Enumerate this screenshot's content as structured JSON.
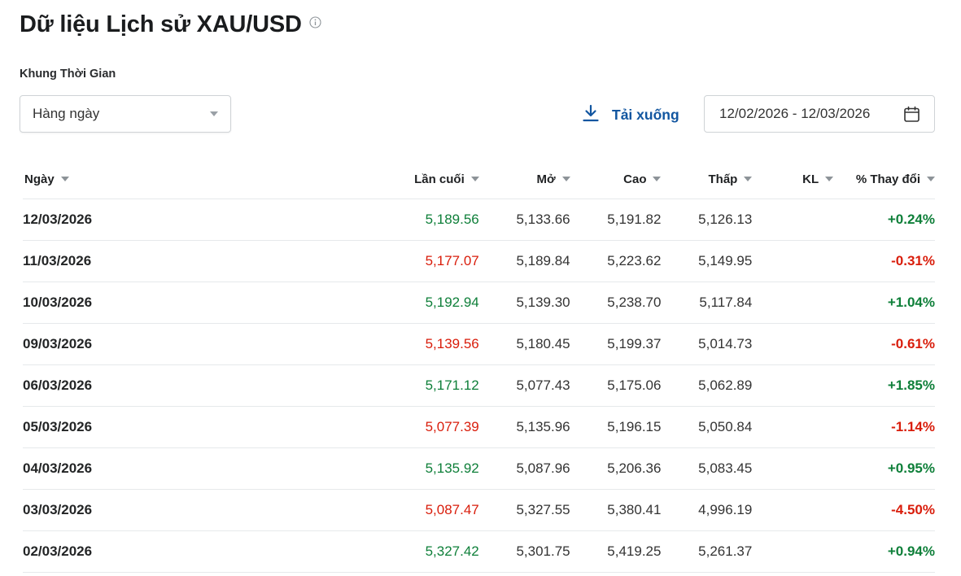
{
  "title": "Dữ liệu Lịch sử XAU/USD",
  "timeframe": {
    "label": "Khung Thời Gian",
    "selected": "Hàng ngày"
  },
  "download": {
    "label": "Tải xuống"
  },
  "date_range": "12/02/2026 - 12/03/2026",
  "colors": {
    "positive": "#0e7f39",
    "negative": "#d91d0b",
    "link": "#1256a0"
  },
  "table": {
    "headers": {
      "date": "Ngày",
      "last": "Lần cuối",
      "open": "Mở",
      "high": "Cao",
      "low": "Thấp",
      "volume": "KL",
      "change": "% Thay đổi"
    },
    "rows": [
      {
        "date": "12/03/2026",
        "last": "5,189.56",
        "open": "5,133.66",
        "high": "5,191.82",
        "low": "5,126.13",
        "volume": "",
        "change": "+0.24%",
        "dir": "pos"
      },
      {
        "date": "11/03/2026",
        "last": "5,177.07",
        "open": "5,189.84",
        "high": "5,223.62",
        "low": "5,149.95",
        "volume": "",
        "change": "-0.31%",
        "dir": "neg"
      },
      {
        "date": "10/03/2026",
        "last": "5,192.94",
        "open": "5,139.30",
        "high": "5,238.70",
        "low": "5,117.84",
        "volume": "",
        "change": "+1.04%",
        "dir": "pos"
      },
      {
        "date": "09/03/2026",
        "last": "5,139.56",
        "open": "5,180.45",
        "high": "5,199.37",
        "low": "5,014.73",
        "volume": "",
        "change": "-0.61%",
        "dir": "neg"
      },
      {
        "date": "06/03/2026",
        "last": "5,171.12",
        "open": "5,077.43",
        "high": "5,175.06",
        "low": "5,062.89",
        "volume": "",
        "change": "+1.85%",
        "dir": "pos"
      },
      {
        "date": "05/03/2026",
        "last": "5,077.39",
        "open": "5,135.96",
        "high": "5,196.15",
        "low": "5,050.84",
        "volume": "",
        "change": "-1.14%",
        "dir": "neg"
      },
      {
        "date": "04/03/2026",
        "last": "5,135.92",
        "open": "5,087.96",
        "high": "5,206.36",
        "low": "5,083.45",
        "volume": "",
        "change": "+0.95%",
        "dir": "pos"
      },
      {
        "date": "03/03/2026",
        "last": "5,087.47",
        "open": "5,327.55",
        "high": "5,380.41",
        "low": "4,996.19",
        "volume": "",
        "change": "-4.50%",
        "dir": "neg"
      },
      {
        "date": "02/03/2026",
        "last": "5,327.42",
        "open": "5,301.75",
        "high": "5,419.25",
        "low": "5,261.37",
        "volume": "",
        "change": "+0.94%",
        "dir": "pos"
      }
    ]
  }
}
